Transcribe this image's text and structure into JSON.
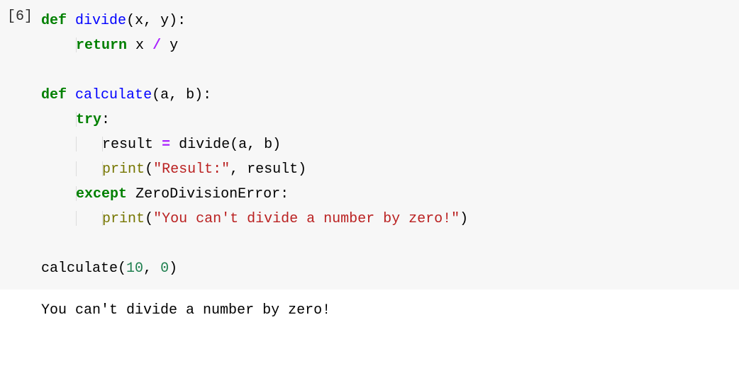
{
  "cell": {
    "prompt": "[6]",
    "code": {
      "line1": {
        "def": "def",
        "name": "divide",
        "open": "(",
        "arg1": "x",
        "comma1": ", ",
        "arg2": "y",
        "close": "):"
      },
      "line2": {
        "ret": "return",
        "expr_x": " x ",
        "op": "/",
        "expr_y": " y"
      },
      "line4": {
        "def": "def",
        "name": "calculate",
        "open": "(",
        "arg1": "a",
        "comma1": ", ",
        "arg2": "b",
        "close": "):"
      },
      "line5": {
        "try": "try",
        "colon": ":"
      },
      "line6": {
        "text": "result ",
        "eq": "=",
        "rest": " divide(a, b)"
      },
      "line7": {
        "print": "print",
        "open": "(",
        "str": "\"Result:\"",
        "rest": ", result)"
      },
      "line8": {
        "except": "except",
        "sp": " ",
        "exc": "ZeroDivisionError",
        "colon": ":"
      },
      "line9": {
        "print": "print",
        "open": "(",
        "str": "\"You can't divide a number by zero!\"",
        "close": ")"
      },
      "line11": {
        "call": "calculate(",
        "n1": "10",
        "comma": ", ",
        "n2": "0",
        "close": ")"
      }
    },
    "output": "You can't divide a number by zero!"
  }
}
